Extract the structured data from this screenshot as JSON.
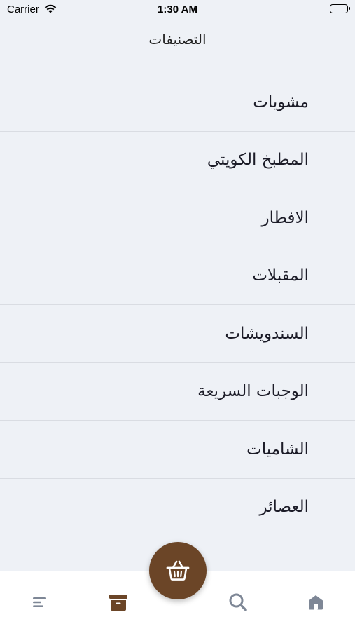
{
  "status_bar": {
    "carrier": "Carrier",
    "time": "1:30 AM",
    "icons": [
      "wifi-icon",
      "battery-icon"
    ]
  },
  "nav": {
    "title": "التصنيفات"
  },
  "categories": [
    {
      "label": "مشويات"
    },
    {
      "label": "المطبخ الكويتي"
    },
    {
      "label": "الافطار"
    },
    {
      "label": "المقبلات"
    },
    {
      "label": "السندويشات"
    },
    {
      "label": "الوجبات السريعة"
    },
    {
      "label": "الشاميات"
    },
    {
      "label": "العصائر"
    },
    {
      "label": ""
    }
  ],
  "tab_bar": {
    "items": [
      {
        "icon": "menu-icon",
        "active": false
      },
      {
        "icon": "orders-box-icon",
        "active": true
      },
      {
        "icon": "search-icon",
        "active": false
      },
      {
        "icon": "home-icon",
        "active": false
      }
    ],
    "cart_icon": "basket-icon"
  },
  "colors": {
    "background": "#eef1f6",
    "accent_brown": "#6b4527",
    "inactive_icon": "#7e8796",
    "divider": "#d9dce2"
  }
}
